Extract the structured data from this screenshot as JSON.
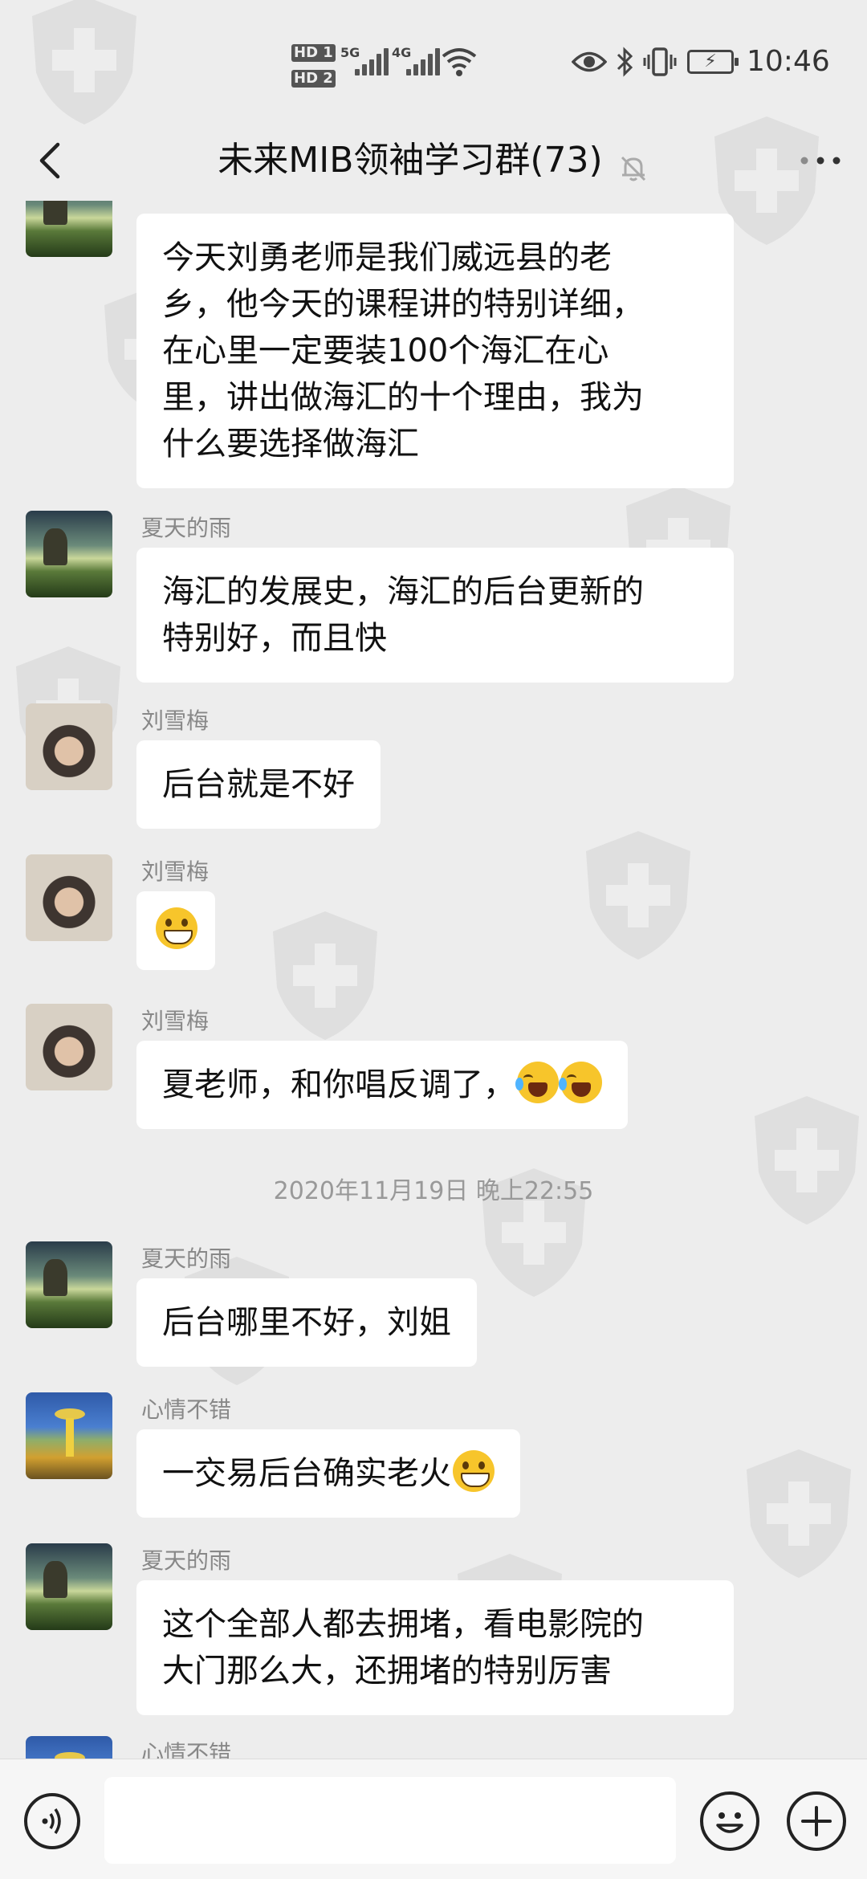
{
  "status_bar": {
    "hd1": "HD 1",
    "hd2": "HD 2",
    "net1": "5G",
    "net2": "4G",
    "time": "10:46"
  },
  "header": {
    "title": "未来MIB领袖学习群(73)"
  },
  "messages": [
    {
      "sender": "",
      "avatar": "sky-avatar",
      "lines": [
        "今天刘勇老师是我们威远县的老",
        "乡，他今天的课程讲的特别详细，",
        "在心里一定要装100个海汇在心",
        "里，讲出做海汇的十个理由，我为",
        "什么要选择做海汇"
      ]
    },
    {
      "sender": "夏天的雨",
      "avatar": "sky-avatar",
      "lines": [
        "海汇的发展史，海汇的后台更新的",
        "特别好，而且快"
      ]
    },
    {
      "sender": "刘雪梅",
      "avatar": "liu-avatar",
      "text": "后台就是不好"
    },
    {
      "sender": "刘雪梅",
      "avatar": "liu-avatar",
      "emoji": "grin"
    },
    {
      "sender": "刘雪梅",
      "avatar": "liu-avatar",
      "text": "夏老师，和你唱反调了，"
    },
    {
      "sender": "夏天的雨",
      "avatar": "sky-avatar",
      "text": "后台哪里不好，刘姐"
    },
    {
      "sender": "心情不错",
      "avatar": "xin-avatar",
      "text": "一交易后台确实老火"
    },
    {
      "sender": "夏天的雨",
      "avatar": "sky-avatar",
      "lines": [
        "这个全部人都去拥堵，看电影院的",
        "大门那么大，还拥堵的特别厉害"
      ]
    },
    {
      "sender": "心情不错",
      "avatar": "xin-avatar"
    }
  ],
  "timestamp": "2020年11月19日 晚上22:55",
  "colors": {
    "background": "#ededed",
    "bubble": "#ffffff",
    "name_text": "#888888",
    "emoji": "#f7c52b"
  }
}
